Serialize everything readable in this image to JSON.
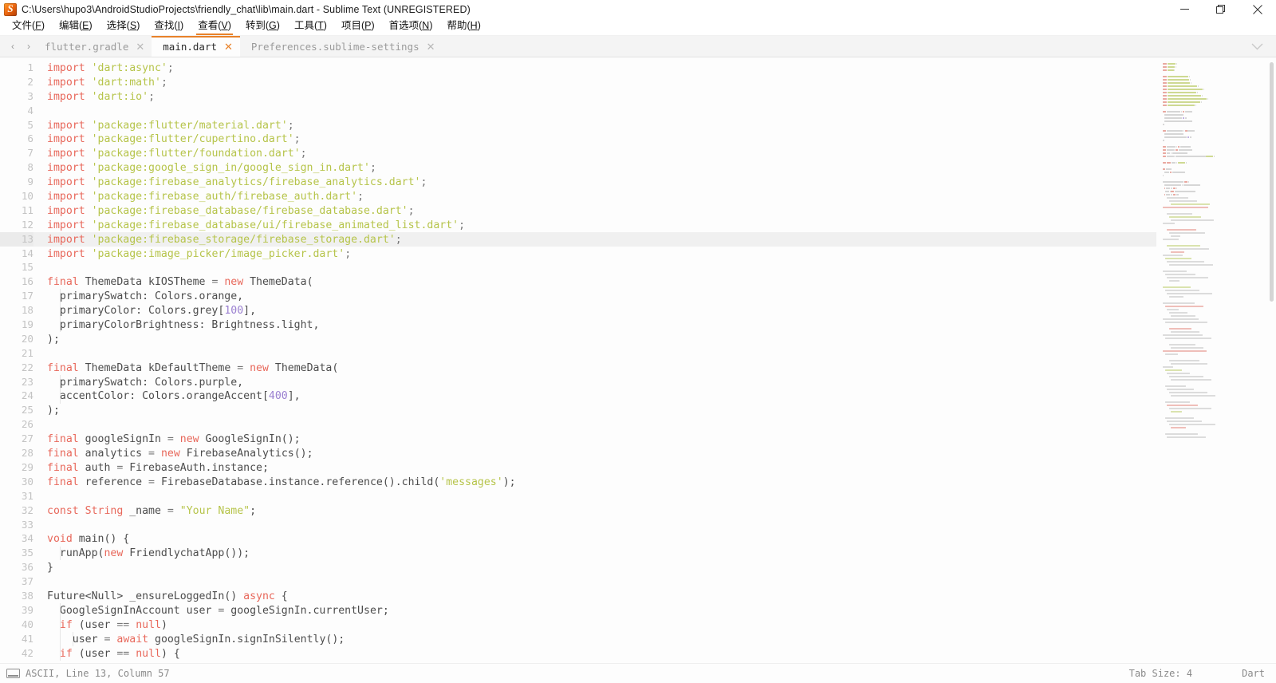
{
  "window": {
    "title": "C:\\Users\\hupo3\\AndroidStudioProjects\\friendly_chat\\lib\\main.dart - Sublime Text (UNREGISTERED)",
    "icon": "sublime-text-icon",
    "controls": {
      "minimize": "minimize-icon",
      "maximize": "restore-icon",
      "close": "close-icon"
    }
  },
  "menubar": {
    "items": [
      {
        "label": "文件",
        "accel": "F"
      },
      {
        "label": "编辑",
        "accel": "E"
      },
      {
        "label": "选择",
        "accel": "S"
      },
      {
        "label": "查找",
        "accel": "I"
      },
      {
        "label": "查看",
        "accel": "V",
        "active": true
      },
      {
        "label": "转到",
        "accel": "G"
      },
      {
        "label": "工具",
        "accel": "T"
      },
      {
        "label": "项目",
        "accel": "P"
      },
      {
        "label": "首选项",
        "accel": "N"
      },
      {
        "label": "帮助",
        "accel": "H"
      }
    ]
  },
  "tabbar": {
    "nav_back": "‹",
    "nav_forward": "›",
    "close_glyph": "✕",
    "overflow_icon": "chevron-down-icon",
    "tabs": [
      {
        "label": "flutter.gradle",
        "active": false
      },
      {
        "label": "main.dart",
        "active": true
      },
      {
        "label": "Preferences.sublime-settings",
        "active": false
      }
    ]
  },
  "editor": {
    "accent_color": "#e8822a",
    "keyword_color": "#e8685b",
    "string_color": "#b6c44a",
    "number_color": "#9a7fd0",
    "text_color": "#4c4c4c",
    "background": "#fdfdfd",
    "highlight_line": 13,
    "first_line": 1,
    "lines": [
      {
        "n": 1,
        "tokens": [
          {
            "t": "k",
            "v": "import"
          },
          {
            "t": "t",
            "v": " "
          },
          {
            "t": "s",
            "v": "'dart:async'"
          },
          {
            "t": "p",
            "v": ";"
          }
        ]
      },
      {
        "n": 2,
        "tokens": [
          {
            "t": "k",
            "v": "import"
          },
          {
            "t": "t",
            "v": " "
          },
          {
            "t": "s",
            "v": "'dart:math'"
          },
          {
            "t": "p",
            "v": ";"
          }
        ]
      },
      {
        "n": 3,
        "tokens": [
          {
            "t": "k",
            "v": "import"
          },
          {
            "t": "t",
            "v": " "
          },
          {
            "t": "s",
            "v": "'dart:io'"
          },
          {
            "t": "p",
            "v": ";"
          }
        ]
      },
      {
        "n": 4,
        "tokens": []
      },
      {
        "n": 5,
        "tokens": [
          {
            "t": "k",
            "v": "import"
          },
          {
            "t": "t",
            "v": " "
          },
          {
            "t": "s",
            "v": "'package:flutter/material.dart'"
          },
          {
            "t": "p",
            "v": ";"
          }
        ]
      },
      {
        "n": 6,
        "tokens": [
          {
            "t": "k",
            "v": "import"
          },
          {
            "t": "t",
            "v": " "
          },
          {
            "t": "s",
            "v": "'package:flutter/cupertino.dart'"
          },
          {
            "t": "p",
            "v": ";"
          }
        ]
      },
      {
        "n": 7,
        "tokens": [
          {
            "t": "k",
            "v": "import"
          },
          {
            "t": "t",
            "v": " "
          },
          {
            "t": "s",
            "v": "'package:flutter/foundation.dart'"
          },
          {
            "t": "p",
            "v": ";"
          }
        ]
      },
      {
        "n": 8,
        "tokens": [
          {
            "t": "k",
            "v": "import"
          },
          {
            "t": "t",
            "v": " "
          },
          {
            "t": "s",
            "v": "'package:google_sign_in/google_sign_in.dart'"
          },
          {
            "t": "p",
            "v": ";"
          }
        ]
      },
      {
        "n": 9,
        "tokens": [
          {
            "t": "k",
            "v": "import"
          },
          {
            "t": "t",
            "v": " "
          },
          {
            "t": "s",
            "v": "'package:firebase_analytics/firebase_analytics.dart'"
          },
          {
            "t": "p",
            "v": ";"
          }
        ]
      },
      {
        "n": 10,
        "tokens": [
          {
            "t": "k",
            "v": "import"
          },
          {
            "t": "t",
            "v": " "
          },
          {
            "t": "s",
            "v": "'package:firebase_auth/firebase_auth.dart'"
          },
          {
            "t": "p",
            "v": ";"
          }
        ]
      },
      {
        "n": 11,
        "tokens": [
          {
            "t": "k",
            "v": "import"
          },
          {
            "t": "t",
            "v": " "
          },
          {
            "t": "s",
            "v": "'package:firebase_database/firebase_database.dart'"
          },
          {
            "t": "p",
            "v": ";"
          }
        ]
      },
      {
        "n": 12,
        "tokens": [
          {
            "t": "k",
            "v": "import"
          },
          {
            "t": "t",
            "v": " "
          },
          {
            "t": "s",
            "v": "'package:firebase_database/ui/firebase_animated_list.dart'"
          },
          {
            "t": "p",
            "v": ";"
          }
        ]
      },
      {
        "n": 13,
        "tokens": [
          {
            "t": "k",
            "v": "import"
          },
          {
            "t": "t",
            "v": " "
          },
          {
            "t": "s",
            "v": "'package:firebase_storage/firebase_storage.dart'"
          },
          {
            "t": "p",
            "v": ";"
          }
        ]
      },
      {
        "n": 14,
        "tokens": [
          {
            "t": "k",
            "v": "import"
          },
          {
            "t": "t",
            "v": " "
          },
          {
            "t": "s",
            "v": "'package:image_picker/image_picker.dart'"
          },
          {
            "t": "p",
            "v": ";"
          }
        ]
      },
      {
        "n": 15,
        "tokens": []
      },
      {
        "n": 16,
        "tokens": [
          {
            "t": "k",
            "v": "final"
          },
          {
            "t": "t",
            "v": " ThemeData kIOSTheme "
          },
          {
            "t": "p",
            "v": "="
          },
          {
            "t": "t",
            "v": " "
          },
          {
            "t": "k",
            "v": "new"
          },
          {
            "t": "t",
            "v": " ThemeData("
          }
        ]
      },
      {
        "n": 17,
        "tokens": [
          {
            "t": "t",
            "v": "  primarySwatch: Colors.orange,"
          }
        ]
      },
      {
        "n": 18,
        "tokens": [
          {
            "t": "t",
            "v": "  primaryColor: Colors.grey["
          },
          {
            "t": "n",
            "v": "100"
          },
          {
            "t": "t",
            "v": "],"
          }
        ]
      },
      {
        "n": 19,
        "tokens": [
          {
            "t": "t",
            "v": "  primaryColorBrightness: Brightness.light,"
          }
        ]
      },
      {
        "n": 20,
        "tokens": [
          {
            "t": "t",
            "v": ");"
          }
        ]
      },
      {
        "n": 21,
        "tokens": []
      },
      {
        "n": 22,
        "tokens": [
          {
            "t": "k",
            "v": "final"
          },
          {
            "t": "t",
            "v": " ThemeData kDefaultTheme "
          },
          {
            "t": "p",
            "v": "="
          },
          {
            "t": "t",
            "v": " "
          },
          {
            "t": "k",
            "v": "new"
          },
          {
            "t": "t",
            "v": " ThemeData("
          }
        ]
      },
      {
        "n": 23,
        "tokens": [
          {
            "t": "t",
            "v": "  primarySwatch: Colors.purple,"
          }
        ]
      },
      {
        "n": 24,
        "tokens": [
          {
            "t": "t",
            "v": "  accentColor: Colors.orangeAccent["
          },
          {
            "t": "n",
            "v": "400"
          },
          {
            "t": "t",
            "v": "],"
          }
        ]
      },
      {
        "n": 25,
        "tokens": [
          {
            "t": "t",
            "v": ");"
          }
        ]
      },
      {
        "n": 26,
        "tokens": []
      },
      {
        "n": 27,
        "tokens": [
          {
            "t": "k",
            "v": "final"
          },
          {
            "t": "t",
            "v": " googleSignIn "
          },
          {
            "t": "p",
            "v": "="
          },
          {
            "t": "t",
            "v": " "
          },
          {
            "t": "k",
            "v": "new"
          },
          {
            "t": "t",
            "v": " GoogleSignIn();"
          }
        ]
      },
      {
        "n": 28,
        "tokens": [
          {
            "t": "k",
            "v": "final"
          },
          {
            "t": "t",
            "v": " analytics "
          },
          {
            "t": "p",
            "v": "="
          },
          {
            "t": "t",
            "v": " "
          },
          {
            "t": "k",
            "v": "new"
          },
          {
            "t": "t",
            "v": " FirebaseAnalytics();"
          }
        ]
      },
      {
        "n": 29,
        "tokens": [
          {
            "t": "k",
            "v": "final"
          },
          {
            "t": "t",
            "v": " auth "
          },
          {
            "t": "p",
            "v": "="
          },
          {
            "t": "t",
            "v": " FirebaseAuth.instance;"
          }
        ]
      },
      {
        "n": 30,
        "tokens": [
          {
            "t": "k",
            "v": "final"
          },
          {
            "t": "t",
            "v": " reference "
          },
          {
            "t": "p",
            "v": "="
          },
          {
            "t": "t",
            "v": " FirebaseDatabase.instance.reference().child("
          },
          {
            "t": "s",
            "v": "'messages'"
          },
          {
            "t": "t",
            "v": ");"
          }
        ]
      },
      {
        "n": 31,
        "tokens": []
      },
      {
        "n": 32,
        "tokens": [
          {
            "t": "k",
            "v": "const"
          },
          {
            "t": "t",
            "v": " "
          },
          {
            "t": "k",
            "v": "String"
          },
          {
            "t": "t",
            "v": " _name "
          },
          {
            "t": "p",
            "v": "="
          },
          {
            "t": "t",
            "v": " "
          },
          {
            "t": "s",
            "v": "\"Your Name\""
          },
          {
            "t": "t",
            "v": ";"
          }
        ]
      },
      {
        "n": 33,
        "tokens": []
      },
      {
        "n": 34,
        "tokens": [
          {
            "t": "k",
            "v": "void"
          },
          {
            "t": "t",
            "v": " main() {"
          }
        ]
      },
      {
        "n": 35,
        "tokens": [
          {
            "t": "t",
            "v": "  runApp("
          },
          {
            "t": "k",
            "v": "new"
          },
          {
            "t": "t",
            "v": " FriendlychatApp());"
          }
        ]
      },
      {
        "n": 36,
        "tokens": [
          {
            "t": "t",
            "v": "}"
          }
        ]
      },
      {
        "n": 37,
        "tokens": []
      },
      {
        "n": 38,
        "tokens": [
          {
            "t": "t",
            "v": "Future<Null> _ensureLoggedIn() "
          },
          {
            "t": "k",
            "v": "async"
          },
          {
            "t": "t",
            "v": " {"
          }
        ]
      },
      {
        "n": 39,
        "tokens": [
          {
            "t": "t",
            "v": "  GoogleSignInAccount user "
          },
          {
            "t": "p",
            "v": "="
          },
          {
            "t": "t",
            "v": " googleSignIn.currentUser;"
          }
        ]
      },
      {
        "n": 40,
        "tokens": [
          {
            "t": "t",
            "v": "  "
          },
          {
            "t": "k",
            "v": "if"
          },
          {
            "t": "t",
            "v": " (user "
          },
          {
            "t": "p",
            "v": "=="
          },
          {
            "t": "t",
            "v": " "
          },
          {
            "t": "k",
            "v": "null"
          },
          {
            "t": "t",
            "v": ")"
          }
        ]
      },
      {
        "n": 41,
        "tokens": [
          {
            "t": "t",
            "v": "    user "
          },
          {
            "t": "p",
            "v": "="
          },
          {
            "t": "t",
            "v": " "
          },
          {
            "t": "k",
            "v": "await"
          },
          {
            "t": "t",
            "v": " googleSignIn.signInSilently();"
          }
        ]
      },
      {
        "n": 42,
        "tokens": [
          {
            "t": "t",
            "v": "  "
          },
          {
            "t": "k",
            "v": "if"
          },
          {
            "t": "t",
            "v": " (user "
          },
          {
            "t": "p",
            "v": "=="
          },
          {
            "t": "t",
            "v": " "
          },
          {
            "t": "k",
            "v": "null"
          },
          {
            "t": "t",
            "v": ") {"
          }
        ]
      }
    ]
  },
  "minimap": {
    "name": "code-minimap"
  },
  "statusbar": {
    "encoding_icon": "encoding-icon",
    "position": "ASCII, Line 13, Column 57",
    "tab_size": "Tab Size: 4",
    "syntax": "Dart"
  }
}
